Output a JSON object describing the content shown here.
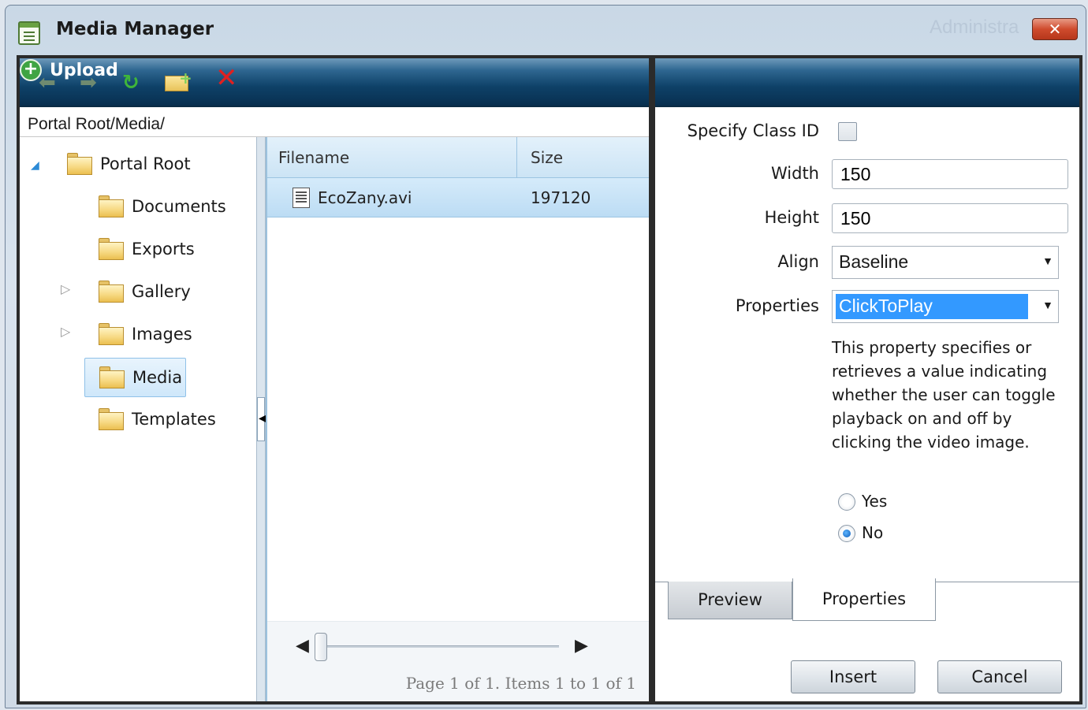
{
  "window": {
    "title": "Media Manager",
    "background_text": "Administra",
    "close_label": "✕"
  },
  "toolbar": {
    "back_icon": "arrow-left-icon",
    "forward_icon": "arrow-right-icon",
    "refresh_icon": "refresh-icon",
    "new_folder_icon": "new-folder-icon",
    "delete_icon": "delete-icon",
    "upload_label": "Upload"
  },
  "path": "Portal Root/Media/",
  "tree": {
    "items": [
      {
        "label": "Portal Root"
      },
      {
        "label": "Documents"
      },
      {
        "label": "Exports"
      },
      {
        "label": "Gallery"
      },
      {
        "label": "Images"
      },
      {
        "label": "Media",
        "selected": true
      },
      {
        "label": "Templates"
      }
    ]
  },
  "grid": {
    "columns": [
      "Filename",
      "Size"
    ],
    "rows": [
      {
        "filename": "EcoZany.avi",
        "size": "197120"
      }
    ],
    "pager_info": "Page 1 of 1. Items 1 to 1 of 1"
  },
  "properties": {
    "class_id_label": "Specify Class ID",
    "width_label": "Width",
    "width_value": "150",
    "height_label": "Height",
    "height_value": "150",
    "align_label": "Align",
    "align_value": "Baseline",
    "properties_label": "Properties",
    "properties_value": "ClickToPlay",
    "description": "This property specifies or retrieves a value indicating whether the user can toggle playback on and off by clicking the video image.",
    "yes_label": "Yes",
    "no_label": "No",
    "selected_option": "No"
  },
  "tabs": {
    "preview_label": "Preview",
    "properties_label": "Properties",
    "active": "Properties"
  },
  "buttons": {
    "insert_label": "Insert",
    "cancel_label": "Cancel"
  },
  "colors": {
    "toolbar_dark": "#0e4168",
    "selection": "#3399ff",
    "grid_row_selected": "#bcdcf4"
  }
}
